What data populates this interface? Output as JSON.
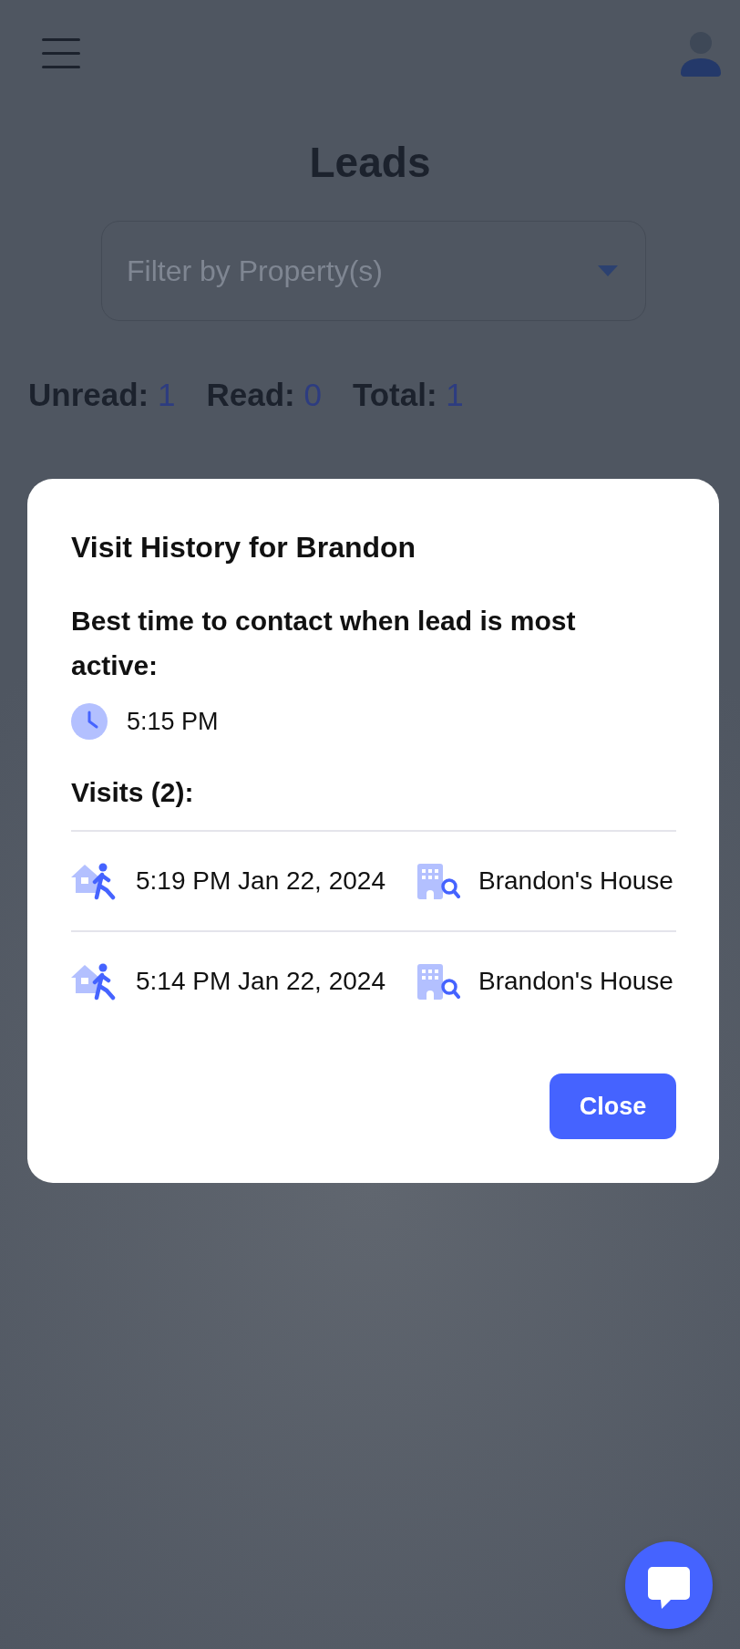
{
  "header": {
    "title": "Leads"
  },
  "filter": {
    "placeholder": "Filter by Property(s)"
  },
  "counts": [
    {
      "label": "Unread:",
      "value": "1"
    },
    {
      "label": "Read:",
      "value": "0"
    },
    {
      "label": "Total:",
      "value": "1"
    }
  ],
  "modal": {
    "title": "Visit History for Brandon",
    "best_time_label": "Best time to contact when lead is most active:",
    "best_time": "5:15 PM",
    "visits_label": "Visits (2):",
    "visits": [
      {
        "time": "5:19 PM Jan 22, 2024",
        "property": "Brandon's House"
      },
      {
        "time": "5:14 PM Jan 22, 2024",
        "property": "Brandon's House"
      }
    ],
    "close_button": "Close"
  }
}
